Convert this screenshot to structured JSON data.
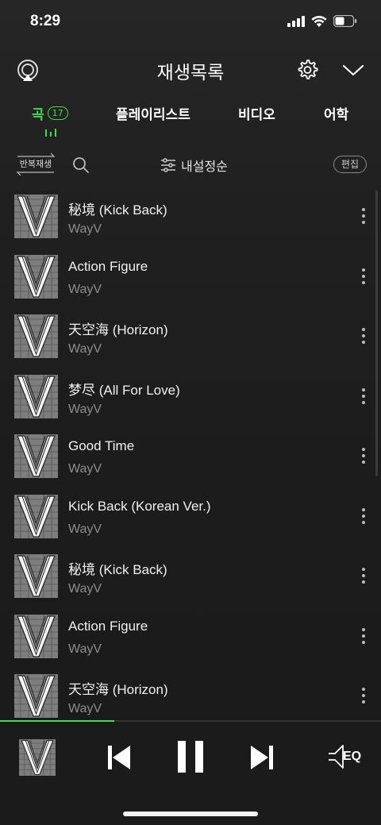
{
  "status": {
    "time": "8:29"
  },
  "header": {
    "title": "재생목록"
  },
  "tabs": [
    {
      "label": "곡",
      "count": "17"
    },
    {
      "label": "플레이리스트"
    },
    {
      "label": "비디오"
    },
    {
      "label": "어학"
    }
  ],
  "toolbar": {
    "repeat_label": "반복재생",
    "sort_label": "내설정순",
    "edit_label": "편집"
  },
  "songs": [
    {
      "title": "秘境 (Kick Back)",
      "artist": "WayV"
    },
    {
      "title": "Action Figure",
      "artist": "WayV"
    },
    {
      "title": "天空海 (Horizon)",
      "artist": "WayV"
    },
    {
      "title": "梦尽 (All For Love)",
      "artist": "WayV"
    },
    {
      "title": "Good Time",
      "artist": "WayV"
    },
    {
      "title": "Kick Back (Korean Ver.)",
      "artist": "WayV"
    },
    {
      "title": "秘境 (Kick Back)",
      "artist": "WayV"
    },
    {
      "title": "Action Figure",
      "artist": "WayV"
    },
    {
      "title": "天空海 (Horizon)",
      "artist": "WayV"
    }
  ],
  "player": {
    "eq_label": "EQ",
    "progress": 0.3
  },
  "colors": {
    "accent": "#3ddc4a",
    "background": "#1f1f1f"
  }
}
